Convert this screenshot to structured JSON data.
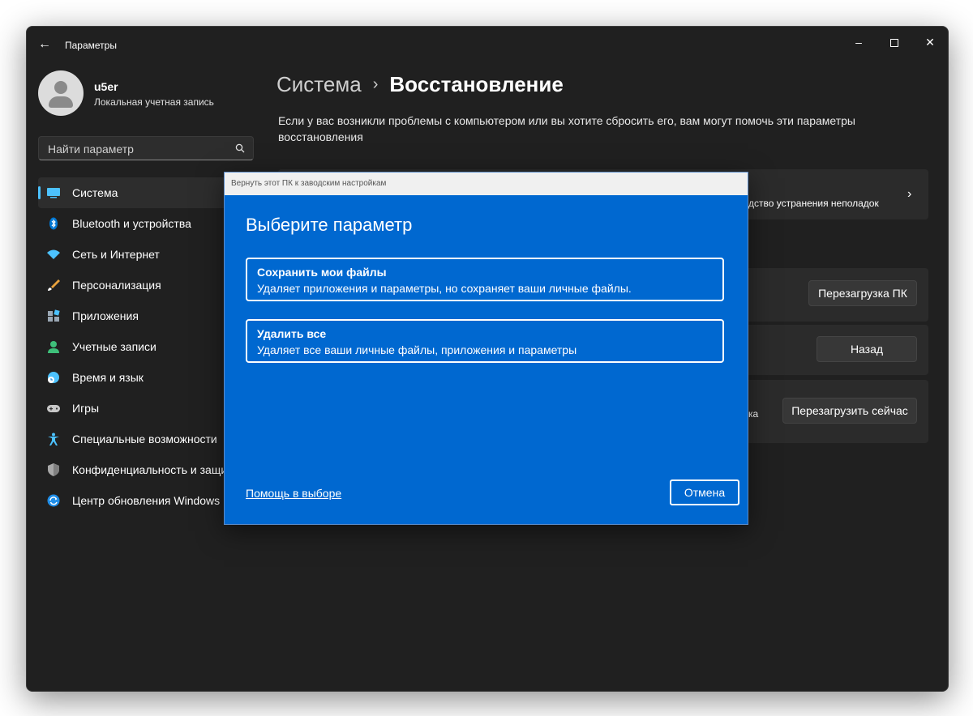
{
  "window": {
    "title": "Параметры",
    "back_icon": "back-arrow-icon",
    "controls": [
      "minimize-icon",
      "maximize-icon",
      "close-icon"
    ]
  },
  "user": {
    "name": "u5er",
    "account_type": "Локальная учетная запись"
  },
  "search": {
    "placeholder": "Найти параметр",
    "icon": "search-icon"
  },
  "sidebar": {
    "items": [
      {
        "label": "Система",
        "icon": "system-icon",
        "active": true
      },
      {
        "label": "Bluetooth и устройства",
        "icon": "bluetooth-icon"
      },
      {
        "label": "Сеть и Интернет",
        "icon": "wifi-icon"
      },
      {
        "label": "Персонализация",
        "icon": "brush-icon"
      },
      {
        "label": "Приложения",
        "icon": "apps-icon"
      },
      {
        "label": "Учетные записи",
        "icon": "accounts-icon"
      },
      {
        "label": "Время и язык",
        "icon": "time-language-icon"
      },
      {
        "label": "Игры",
        "icon": "gamepad-icon"
      },
      {
        "label": "Специальные возможности",
        "icon": "accessibility-icon"
      },
      {
        "label": "Конфиденциальность и защи",
        "icon": "shield-icon"
      },
      {
        "label": "Центр обновления Windows",
        "icon": "windows-update-icon"
      }
    ]
  },
  "main": {
    "breadcrumb_parent": "Система",
    "breadcrumb_current": "Восстановление",
    "description": "Если у вас возникли проблемы с компьютером или вы хотите сбросить его, вам могут помочь эти параметры восстановления",
    "troubleshoot_text": "дство устранения неполадок",
    "reset_button": "Перезагрузка ПК",
    "back_button": "Назад",
    "startup_text": "ка",
    "restart_now_button": "Перезагрузить сейчас"
  },
  "dialog": {
    "title": "Вернуть этот ПК к заводским настройкам",
    "heading": "Выберите параметр",
    "options": [
      {
        "title": "Сохранить мои файлы",
        "description": "Удаляет приложения и параметры, но сохраняет ваши личные файлы."
      },
      {
        "title": "Удалить все",
        "description": "Удаляет все ваши личные файлы, приложения и параметры"
      }
    ],
    "help_link": "Помощь в выборе",
    "cancel_button": "Отмена"
  },
  "colors": {
    "window_bg": "#202020",
    "dialog_bg": "#0068d0",
    "accent": "#4cc2ff"
  }
}
